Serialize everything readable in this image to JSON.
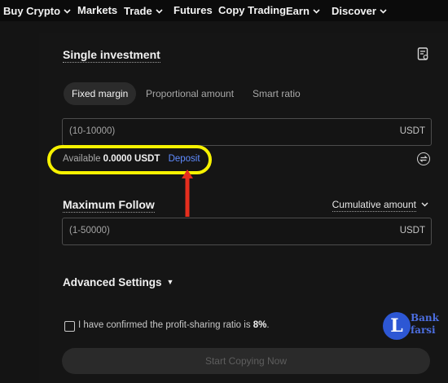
{
  "nav": {
    "items": [
      {
        "label": "Buy Crypto",
        "dropdown": true
      },
      {
        "label": "Markets",
        "dropdown": false
      },
      {
        "label": "Trade",
        "dropdown": true
      },
      {
        "label": "Futures",
        "dropdown": false
      },
      {
        "label": "Copy Trading",
        "dropdown": false
      },
      {
        "label": "Earn",
        "dropdown": true
      },
      {
        "label": "Discover",
        "dropdown": true
      }
    ]
  },
  "single": {
    "title": "Single investment",
    "tabs": [
      {
        "label": "Fixed margin",
        "active": true
      },
      {
        "label": "Proportional amount",
        "active": false
      },
      {
        "label": "Smart ratio",
        "active": false
      }
    ],
    "amount_placeholder": "(10-10000)",
    "amount_unit": "USDT",
    "available_label": "Available",
    "available_value": "0.0000 USDT",
    "deposit_label": "Deposit"
  },
  "max_follow": {
    "title": "Maximum Follow",
    "mode_label": "Cumulative amount",
    "placeholder": "(1-50000)",
    "unit": "USDT"
  },
  "advanced": {
    "label": "Advanced Settings"
  },
  "confirm": {
    "text": "I have confirmed the profit-sharing ratio is",
    "ratio": "8%",
    "suffix": ".",
    "checked": false
  },
  "start_button": "Start Copying Now",
  "watermark": {
    "letter": "L",
    "line1": "Bank",
    "line2": "farsi"
  },
  "colors": {
    "highlight": "#f7f200",
    "arrow": "#e52e1e",
    "link": "#5f8bff",
    "watermark": "#2d57d4"
  },
  "icons": {
    "doc": "document-icon",
    "swap": "swap-icon"
  }
}
